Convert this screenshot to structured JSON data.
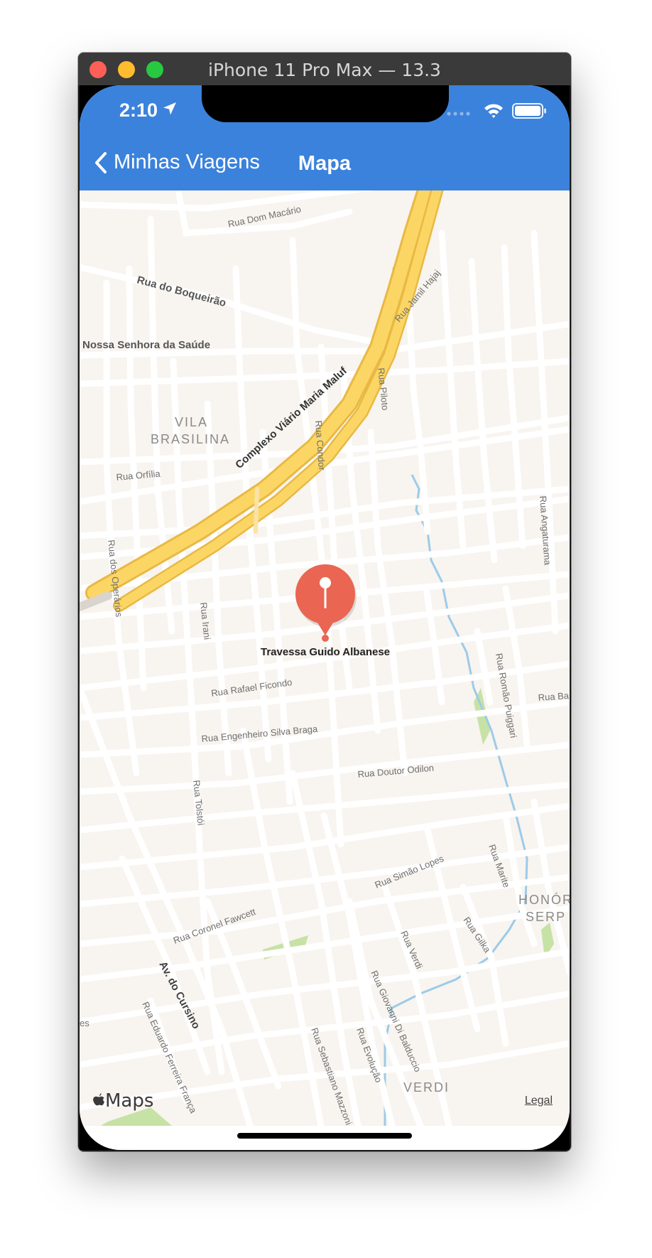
{
  "window": {
    "title": "iPhone 11 Pro Max — 13.3"
  },
  "status_bar": {
    "time": "2:10"
  },
  "nav": {
    "back_label": "Minhas Viagens",
    "title": "Mapa"
  },
  "map": {
    "pin_label": "Travessa Guido Albanese",
    "labels": {
      "rua_dom_macario": "Rua Dom Macário",
      "rua_do_boqueirao": "Rua do Boqueirão",
      "nossa_senhora": "Nossa Senhora da Saúde",
      "rua_jamil_hajaj": "Rua Jamil Hajaj",
      "complexo": "Complexo Viário Maria Maluf",
      "vila": "VILA",
      "brasilina": "BRASILINA",
      "rua_piloto": "Rua Piloto",
      "rua_condor": "Rua Condor",
      "rua_orfilia": "Rua Orfília",
      "rua_angaturama": "Rua Angaturama",
      "rua_dos_operarios": "Rua dos Operários",
      "rua_irani": "Rua Irani",
      "rua_rafael_ficondo": "Rua Rafael Ficondo",
      "rua_romao_puiggari": "Rua Romão Puiggari",
      "rua_ba": "Rua Ba",
      "rua_engenheiro": "Rua Engenheiro Silva Braga",
      "rua_doutor_odilon": "Rua Doutor Odilon",
      "rua_tolstoi": "Rua Tolstói",
      "rua_simao_lopes": "Rua Simão Lopes",
      "rua_marite": "Rua Marite",
      "honor": "HONÓR",
      "serp": "SERP",
      "rua_coronel_fawcett": "Rua Coronel Fawcett",
      "av_do_cursino": "Av. do Cursino",
      "rua_verdi": "Rua Verdi",
      "rua_gilka": "Rua Gilka",
      "rua_giovanni": "Rua Giovanni Di Balduccio",
      "rua_eduardo": "Rua Eduardo Ferreira França",
      "rua_sebastiano": "Rua Sebastiano Mazzoni",
      "rua_evolucao": "Rua Evolução",
      "verdi": "VERDI",
      "rua_es": "es"
    }
  },
  "attribution": {
    "maps": "Maps",
    "legal": "Legal"
  },
  "colors": {
    "nav_bar": "#3b82dc",
    "map_background": "#f8f4ef",
    "highway": "#fcd665",
    "pin": "#ea6552",
    "park": "#c6e2a5",
    "water": "#9ccbe9"
  }
}
